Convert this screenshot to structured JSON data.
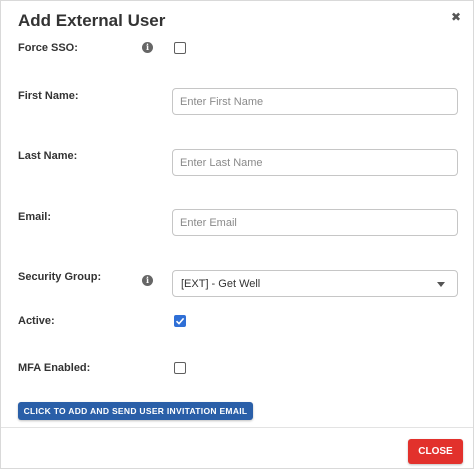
{
  "dialog": {
    "title": "Add External User",
    "close_icon": "close-icon"
  },
  "fields": {
    "force_sso": {
      "label": "Force SSO:",
      "checked": false,
      "info_icon": "info-icon"
    },
    "first_name": {
      "label": "First Name:",
      "value": "",
      "placeholder": "Enter First Name"
    },
    "last_name": {
      "label": "Last Name:",
      "value": "",
      "placeholder": "Enter Last Name"
    },
    "email": {
      "label": "Email:",
      "value": "",
      "placeholder": "Enter Email"
    },
    "security_group": {
      "label": "Security Group:",
      "selected": "[EXT] - Get Well",
      "info_icon": "info-icon"
    },
    "active": {
      "label": "Active:",
      "checked": true
    },
    "mfa_enabled": {
      "label": "MFA Enabled:",
      "checked": false
    }
  },
  "actions": {
    "invite_label": "CLICK TO ADD AND SEND USER INVITATION EMAIL",
    "close_label": "CLOSE"
  },
  "colors": {
    "primary": "#2a5fa8",
    "checkbox_checked": "#2f6fd6",
    "danger": "#e2312c"
  }
}
